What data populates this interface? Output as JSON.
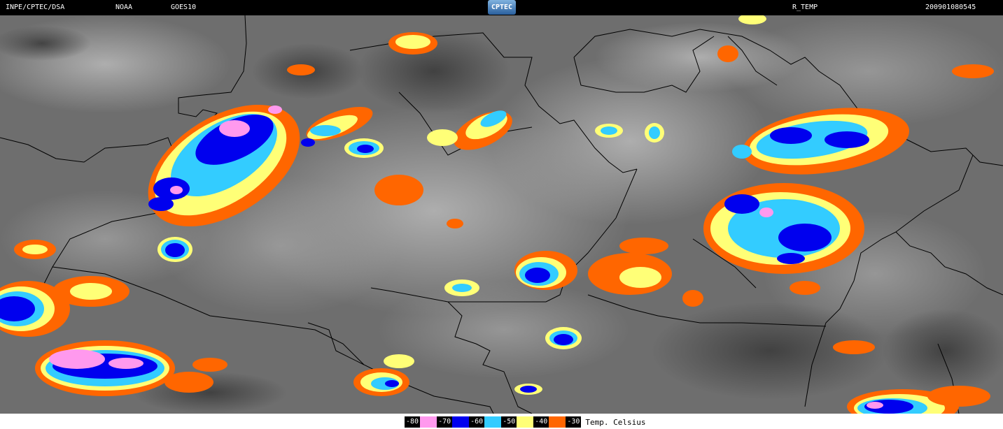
{
  "header": {
    "source": "INPE/CPTEC/DSA",
    "agency": "NOAA",
    "satellite": "GOES10",
    "logo_text": "CPTEC",
    "product": "R_TEMP",
    "timestamp": "200901080545"
  },
  "legend": {
    "items": [
      {
        "label": "-80",
        "color": "#ff99ee"
      },
      {
        "label": "-70",
        "color": "#0000ee"
      },
      {
        "label": "-60",
        "color": "#33ccff"
      },
      {
        "label": "-50",
        "color": "#ffff77"
      },
      {
        "label": "-40",
        "color": "#ff6600"
      },
      {
        "label": "-30",
        "color": ""
      }
    ],
    "caption": "Temp. Celsius"
  }
}
